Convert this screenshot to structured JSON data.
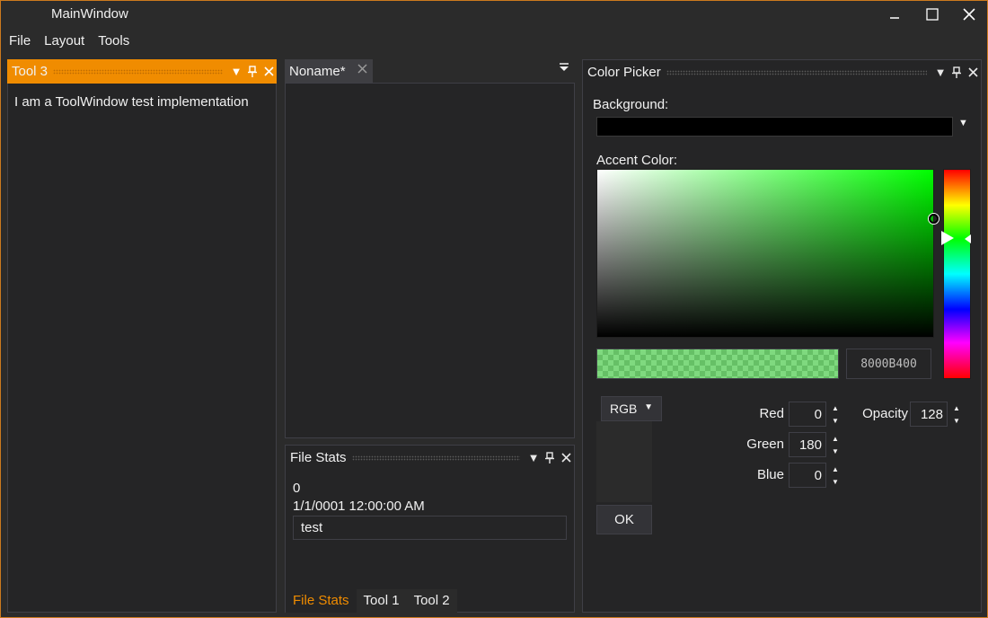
{
  "window": {
    "title": "MainWindow",
    "minimize_icon": "minimize-icon",
    "maximize_icon": "maximize-icon",
    "close_icon": "close-icon"
  },
  "menu": [
    "File",
    "Layout",
    "Tools"
  ],
  "tool3": {
    "title": "Tool 3",
    "content": "I am a ToolWindow test implementation"
  },
  "document": {
    "tab_label": "Noname*"
  },
  "file_stats": {
    "title": "File Stats",
    "value": "0",
    "date": "1/1/0001 12:00:00 AM",
    "text": "test",
    "tabs": [
      "File Stats",
      "Tool 1",
      "Tool 2"
    ],
    "active_tab": "File Stats"
  },
  "color_picker": {
    "title": "Color Picker",
    "background_label": "Background:",
    "background_value": "#000000",
    "accent_label": "Accent Color:",
    "hex_value": "8000B400",
    "mode": "RGB",
    "red_label": "Red",
    "red": "0",
    "green_label": "Green",
    "green": "180",
    "blue_label": "Blue",
    "blue": "0",
    "opacity_label": "Opacity",
    "opacity": "128",
    "ok_label": "OK",
    "accent_color": "#00b400",
    "accent_opacity": 0.502
  },
  "colors": {
    "accent_orange": "#f08c00",
    "window_border": "#cc7a1e",
    "background": "#2b2b2b",
    "pane_background": "#252526"
  }
}
